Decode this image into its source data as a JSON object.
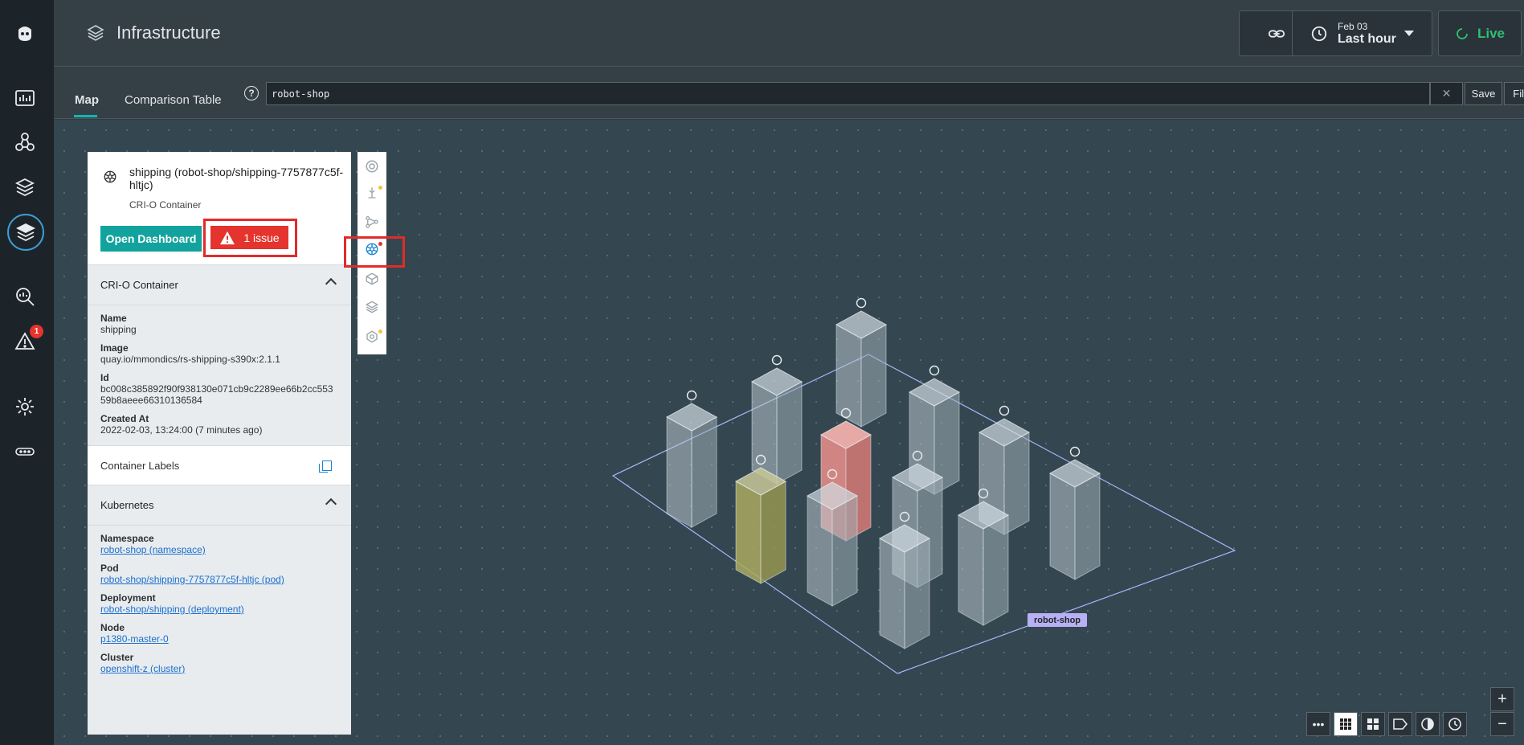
{
  "header": {
    "title": "Infrastructure",
    "time_date": "Feb 03",
    "time_range": "Last hour",
    "live_label": "Live"
  },
  "nav": {
    "issues_badge": "1"
  },
  "tabs": [
    {
      "label": "Map"
    },
    {
      "label": "Comparison Table"
    }
  ],
  "search": {
    "query": "robot-shop",
    "help": "?",
    "clear": "✕",
    "save_label": "Save",
    "filters_label": "Filters"
  },
  "panel": {
    "title": "shipping (robot-shop/shipping-7757877c5f-hltjc)",
    "subtitle": "CRI-O Container",
    "open_dashboard": "Open Dashboard",
    "issue_label": "1 issue",
    "container_section": "CRI-O Container",
    "fields": [
      {
        "label": "Name",
        "value": "shipping"
      },
      {
        "label": "Image",
        "value": "quay.io/mmondics/rs-shipping-s390x:2.1.1"
      },
      {
        "label": "Id",
        "value": "bc008c385892f90f938130e071cb9c2289ee66b2cc55359b8aeee66310136584"
      },
      {
        "label": "Created At",
        "value": "2022-02-03, 13:24:00 (7 minutes ago)"
      }
    ],
    "labels_section": "Container Labels",
    "k8s_section": "Kubernetes",
    "k8s_fields": [
      {
        "label": "Namespace",
        "value": "robot-shop (namespace)"
      },
      {
        "label": "Pod",
        "value": "robot-shop/shipping-7757877c5f-hltjc (pod)"
      },
      {
        "label": "Deployment",
        "value": "robot-shop/shipping (deployment)"
      },
      {
        "label": "Node",
        "value": "p1380-master-0"
      },
      {
        "label": "Cluster",
        "value": "openshift-z (cluster)"
      }
    ]
  },
  "map": {
    "namespace_label": "robot-shop"
  },
  "bottom_tools": {
    "more": "•••",
    "zoom_in": "+",
    "zoom_out": "−"
  },
  "colors": {
    "accent": "#13a39e",
    "issue": "#e5332d",
    "live": "#2fbf71",
    "highlight_box": "#e12b2b"
  }
}
